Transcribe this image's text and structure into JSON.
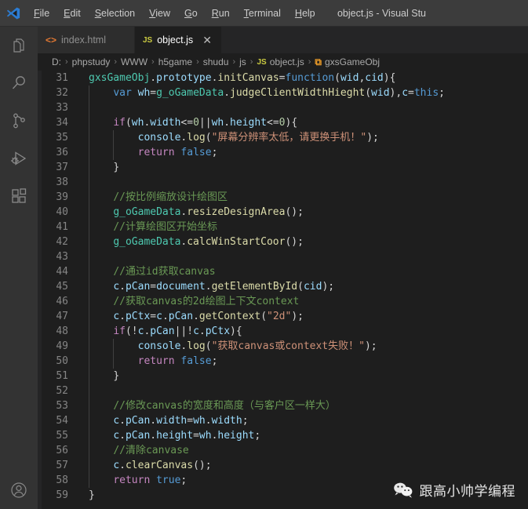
{
  "titlebar": {
    "logo_icon": "vscode-logo-icon",
    "window_title": "object.js - Visual Stu",
    "menus": [
      {
        "label": "File",
        "accel": "F"
      },
      {
        "label": "Edit",
        "accel": "E"
      },
      {
        "label": "Selection",
        "accel": "S"
      },
      {
        "label": "View",
        "accel": "V"
      },
      {
        "label": "Go",
        "accel": "G"
      },
      {
        "label": "Run",
        "accel": "R"
      },
      {
        "label": "Terminal",
        "accel": "T"
      },
      {
        "label": "Help",
        "accel": "H"
      }
    ]
  },
  "activitybar": {
    "items": [
      {
        "name": "explorer",
        "icon": "files-icon",
        "title": "Explorer"
      },
      {
        "name": "search",
        "icon": "search-icon",
        "title": "Search"
      },
      {
        "name": "source-control",
        "icon": "source-control-icon",
        "title": "Source Control"
      },
      {
        "name": "run-debug",
        "icon": "run-and-debug-icon",
        "title": "Run and Debug"
      },
      {
        "name": "extensions",
        "icon": "extensions-icon",
        "title": "Extensions"
      }
    ],
    "bottom_items": [
      {
        "name": "accounts",
        "icon": "account-icon",
        "title": "Accounts"
      }
    ]
  },
  "tabs": [
    {
      "label": "index.html",
      "icon": "html-file-icon",
      "icon_glyph": "<>",
      "active": false,
      "close_glyph": "✕"
    },
    {
      "label": "object.js",
      "icon": "js-file-icon",
      "icon_glyph": "JS",
      "active": true,
      "close_glyph": "✕"
    }
  ],
  "breadcrumb": {
    "separator": "›",
    "segments": [
      {
        "label": "D:",
        "icon": null
      },
      {
        "label": "phpstudy",
        "icon": null
      },
      {
        "label": "WWW",
        "icon": null
      },
      {
        "label": "h5game",
        "icon": null
      },
      {
        "label": "shudu",
        "icon": null
      },
      {
        "label": "js",
        "icon": null
      },
      {
        "label": "object.js",
        "icon": "js-file-icon",
        "icon_glyph": "JS"
      },
      {
        "label": "gxsGameObj",
        "icon": "class-symbol-icon",
        "icon_glyph": "⧉"
      }
    ]
  },
  "editor": {
    "first_line_number": 31,
    "last_line_number": 59,
    "lines": [
      {
        "n": 31,
        "indent": 0,
        "tokens": [
          {
            "t": "gxsGameObj",
            "c": "t-type"
          },
          {
            "t": ".",
            "c": "t-plain"
          },
          {
            "t": "prototype",
            "c": "t-var"
          },
          {
            "t": ".",
            "c": "t-plain"
          },
          {
            "t": "initCanvas",
            "c": "t-fn"
          },
          {
            "t": "=",
            "c": "t-plain"
          },
          {
            "t": "function",
            "c": "t-kw"
          },
          {
            "t": "(",
            "c": "t-plain"
          },
          {
            "t": "wid",
            "c": "t-var"
          },
          {
            "t": ",",
            "c": "t-plain"
          },
          {
            "t": "cid",
            "c": "t-var"
          },
          {
            "t": "){",
            "c": "t-plain"
          }
        ]
      },
      {
        "n": 32,
        "indent": 1,
        "tokens": [
          {
            "t": "var",
            "c": "t-kw"
          },
          {
            "t": " ",
            "c": "t-plain"
          },
          {
            "t": "wh",
            "c": "t-var"
          },
          {
            "t": "=",
            "c": "t-plain"
          },
          {
            "t": "g_oGameData",
            "c": "t-type"
          },
          {
            "t": ".",
            "c": "t-plain"
          },
          {
            "t": "judgeClientWidthHieght",
            "c": "t-fn"
          },
          {
            "t": "(",
            "c": "t-plain"
          },
          {
            "t": "wid",
            "c": "t-var"
          },
          {
            "t": "),",
            "c": "t-plain"
          },
          {
            "t": "c",
            "c": "t-var"
          },
          {
            "t": "=",
            "c": "t-plain"
          },
          {
            "t": "this",
            "c": "t-kw"
          },
          {
            "t": ";",
            "c": "t-plain"
          }
        ]
      },
      {
        "n": 33,
        "indent": 1,
        "tokens": []
      },
      {
        "n": 34,
        "indent": 1,
        "tokens": [
          {
            "t": "if",
            "c": "t-ctl"
          },
          {
            "t": "(",
            "c": "t-plain"
          },
          {
            "t": "wh",
            "c": "t-var"
          },
          {
            "t": ".",
            "c": "t-plain"
          },
          {
            "t": "width",
            "c": "t-var"
          },
          {
            "t": "<=",
            "c": "t-plain"
          },
          {
            "t": "0",
            "c": "t-num"
          },
          {
            "t": "||",
            "c": "t-plain"
          },
          {
            "t": "wh",
            "c": "t-var"
          },
          {
            "t": ".",
            "c": "t-plain"
          },
          {
            "t": "height",
            "c": "t-var"
          },
          {
            "t": "<=",
            "c": "t-plain"
          },
          {
            "t": "0",
            "c": "t-num"
          },
          {
            "t": "){",
            "c": "t-plain"
          }
        ]
      },
      {
        "n": 35,
        "indent": 2,
        "tokens": [
          {
            "t": "console",
            "c": "t-var"
          },
          {
            "t": ".",
            "c": "t-plain"
          },
          {
            "t": "log",
            "c": "t-fn"
          },
          {
            "t": "(",
            "c": "t-plain"
          },
          {
            "t": "\"屏幕分辨率太低，请更换手机！\"",
            "c": "t-str"
          },
          {
            "t": ");",
            "c": "t-plain"
          }
        ]
      },
      {
        "n": 36,
        "indent": 2,
        "tokens": [
          {
            "t": "return",
            "c": "t-ctl"
          },
          {
            "t": " ",
            "c": "t-plain"
          },
          {
            "t": "false",
            "c": "t-kw"
          },
          {
            "t": ";",
            "c": "t-plain"
          }
        ]
      },
      {
        "n": 37,
        "indent": 1,
        "tokens": [
          {
            "t": "}",
            "c": "t-plain"
          }
        ]
      },
      {
        "n": 38,
        "indent": 1,
        "tokens": []
      },
      {
        "n": 39,
        "indent": 1,
        "tokens": [
          {
            "t": "//按比例缩放设计绘图区",
            "c": "t-com"
          }
        ]
      },
      {
        "n": 40,
        "indent": 1,
        "tokens": [
          {
            "t": "g_oGameData",
            "c": "t-type"
          },
          {
            "t": ".",
            "c": "t-plain"
          },
          {
            "t": "resizeDesignArea",
            "c": "t-fn"
          },
          {
            "t": "();",
            "c": "t-plain"
          }
        ]
      },
      {
        "n": 41,
        "indent": 1,
        "tokens": [
          {
            "t": "//计算绘图区开始坐标",
            "c": "t-com"
          }
        ]
      },
      {
        "n": 42,
        "indent": 1,
        "tokens": [
          {
            "t": "g_oGameData",
            "c": "t-type"
          },
          {
            "t": ".",
            "c": "t-plain"
          },
          {
            "t": "calcWinStartCoor",
            "c": "t-fn"
          },
          {
            "t": "();",
            "c": "t-plain"
          }
        ]
      },
      {
        "n": 43,
        "indent": 1,
        "tokens": []
      },
      {
        "n": 44,
        "indent": 1,
        "tokens": [
          {
            "t": "//通过id获取canvas",
            "c": "t-com"
          }
        ]
      },
      {
        "n": 45,
        "indent": 1,
        "tokens": [
          {
            "t": "c",
            "c": "t-var"
          },
          {
            "t": ".",
            "c": "t-plain"
          },
          {
            "t": "pCan",
            "c": "t-var"
          },
          {
            "t": "=",
            "c": "t-plain"
          },
          {
            "t": "document",
            "c": "t-var"
          },
          {
            "t": ".",
            "c": "t-plain"
          },
          {
            "t": "getElementById",
            "c": "t-fn"
          },
          {
            "t": "(",
            "c": "t-plain"
          },
          {
            "t": "cid",
            "c": "t-var"
          },
          {
            "t": ");",
            "c": "t-plain"
          }
        ]
      },
      {
        "n": 46,
        "indent": 1,
        "tokens": [
          {
            "t": "//获取canvas的2d绘图上下文context",
            "c": "t-com"
          }
        ]
      },
      {
        "n": 47,
        "indent": 1,
        "tokens": [
          {
            "t": "c",
            "c": "t-var"
          },
          {
            "t": ".",
            "c": "t-plain"
          },
          {
            "t": "pCtx",
            "c": "t-var"
          },
          {
            "t": "=",
            "c": "t-plain"
          },
          {
            "t": "c",
            "c": "t-var"
          },
          {
            "t": ".",
            "c": "t-plain"
          },
          {
            "t": "pCan",
            "c": "t-var"
          },
          {
            "t": ".",
            "c": "t-plain"
          },
          {
            "t": "getContext",
            "c": "t-fn"
          },
          {
            "t": "(",
            "c": "t-plain"
          },
          {
            "t": "\"2d\"",
            "c": "t-str"
          },
          {
            "t": ");",
            "c": "t-plain"
          }
        ]
      },
      {
        "n": 48,
        "indent": 1,
        "tokens": [
          {
            "t": "if",
            "c": "t-ctl"
          },
          {
            "t": "(!",
            "c": "t-plain"
          },
          {
            "t": "c",
            "c": "t-var"
          },
          {
            "t": ".",
            "c": "t-plain"
          },
          {
            "t": "pCan",
            "c": "t-var"
          },
          {
            "t": "||!",
            "c": "t-plain"
          },
          {
            "t": "c",
            "c": "t-var"
          },
          {
            "t": ".",
            "c": "t-plain"
          },
          {
            "t": "pCtx",
            "c": "t-var"
          },
          {
            "t": "){",
            "c": "t-plain"
          }
        ]
      },
      {
        "n": 49,
        "indent": 2,
        "tokens": [
          {
            "t": "console",
            "c": "t-var"
          },
          {
            "t": ".",
            "c": "t-plain"
          },
          {
            "t": "log",
            "c": "t-fn"
          },
          {
            "t": "(",
            "c": "t-plain"
          },
          {
            "t": "\"获取canvas或context失败！\"",
            "c": "t-str"
          },
          {
            "t": ");",
            "c": "t-plain"
          }
        ]
      },
      {
        "n": 50,
        "indent": 2,
        "tokens": [
          {
            "t": "return",
            "c": "t-ctl"
          },
          {
            "t": " ",
            "c": "t-plain"
          },
          {
            "t": "false",
            "c": "t-kw"
          },
          {
            "t": ";",
            "c": "t-plain"
          }
        ]
      },
      {
        "n": 51,
        "indent": 1,
        "tokens": [
          {
            "t": "}",
            "c": "t-plain"
          }
        ]
      },
      {
        "n": 52,
        "indent": 1,
        "tokens": []
      },
      {
        "n": 53,
        "indent": 1,
        "tokens": [
          {
            "t": "//修改canvas的宽度和高度（与客户区一样大）",
            "c": "t-com"
          }
        ]
      },
      {
        "n": 54,
        "indent": 1,
        "tokens": [
          {
            "t": "c",
            "c": "t-var"
          },
          {
            "t": ".",
            "c": "t-plain"
          },
          {
            "t": "pCan",
            "c": "t-var"
          },
          {
            "t": ".",
            "c": "t-plain"
          },
          {
            "t": "width",
            "c": "t-var"
          },
          {
            "t": "=",
            "c": "t-plain"
          },
          {
            "t": "wh",
            "c": "t-var"
          },
          {
            "t": ".",
            "c": "t-plain"
          },
          {
            "t": "width",
            "c": "t-var"
          },
          {
            "t": ";",
            "c": "t-plain"
          }
        ]
      },
      {
        "n": 55,
        "indent": 1,
        "tokens": [
          {
            "t": "c",
            "c": "t-var"
          },
          {
            "t": ".",
            "c": "t-plain"
          },
          {
            "t": "pCan",
            "c": "t-var"
          },
          {
            "t": ".",
            "c": "t-plain"
          },
          {
            "t": "height",
            "c": "t-var"
          },
          {
            "t": "=",
            "c": "t-plain"
          },
          {
            "t": "wh",
            "c": "t-var"
          },
          {
            "t": ".",
            "c": "t-plain"
          },
          {
            "t": "height",
            "c": "t-var"
          },
          {
            "t": ";",
            "c": "t-plain"
          }
        ]
      },
      {
        "n": 56,
        "indent": 1,
        "tokens": [
          {
            "t": "//清除canvase",
            "c": "t-com"
          }
        ]
      },
      {
        "n": 57,
        "indent": 1,
        "tokens": [
          {
            "t": "c",
            "c": "t-var"
          },
          {
            "t": ".",
            "c": "t-plain"
          },
          {
            "t": "clearCanvas",
            "c": "t-fn"
          },
          {
            "t": "();",
            "c": "t-plain"
          }
        ]
      },
      {
        "n": 58,
        "indent": 1,
        "tokens": [
          {
            "t": "return",
            "c": "t-ctl"
          },
          {
            "t": " ",
            "c": "t-plain"
          },
          {
            "t": "true",
            "c": "t-kw"
          },
          {
            "t": ";",
            "c": "t-plain"
          }
        ]
      },
      {
        "n": 59,
        "indent": 0,
        "tokens": [
          {
            "t": "}",
            "c": "t-plain"
          }
        ]
      }
    ]
  },
  "watermark": {
    "icon": "wechat-icon",
    "text": "跟高小帅学编程"
  },
  "colors": {
    "titlebar_bg": "#3c3c3c",
    "activitybar_bg": "#333333",
    "tabbar_bg": "#252526",
    "tab_active_bg": "#1e1e1e",
    "tab_inactive_bg": "#2d2d2d",
    "editor_bg": "#1e1e1e",
    "line_number": "#858585",
    "keyword": "#569cd6",
    "control": "#c586c0",
    "function": "#dcdcaa",
    "variable": "#9cdcfe",
    "type": "#4ec9b0",
    "string": "#ce9178",
    "comment": "#6a9955",
    "number": "#b5cea8",
    "js_icon": "#cbcb41",
    "html_icon": "#e37933",
    "class_icon": "#ee9d28"
  }
}
